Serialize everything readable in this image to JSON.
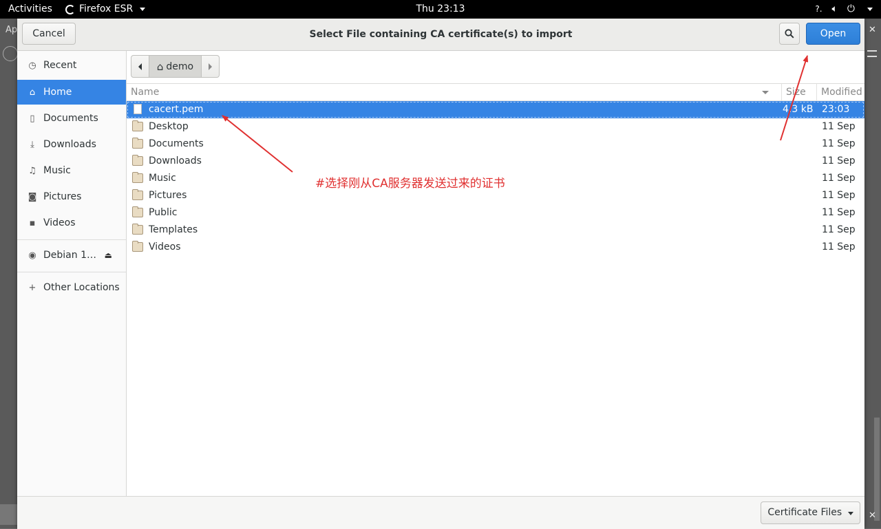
{
  "topbar": {
    "activities": "Activities",
    "app_name": "Firefox ESR",
    "clock": "Thu 23:13"
  },
  "background": {
    "left_stub": "Ap",
    "close_glyph": "✕"
  },
  "dialog": {
    "title": "Select File containing CA certificate(s) to import",
    "cancel_label": "Cancel",
    "open_label": "Open"
  },
  "sidebar": {
    "items": [
      {
        "label": "Recent",
        "icon": "clock-icon",
        "glyph": "◷"
      },
      {
        "label": "Home",
        "icon": "home-icon",
        "glyph": "⌂"
      },
      {
        "label": "Documents",
        "icon": "document-icon",
        "glyph": "▯"
      },
      {
        "label": "Downloads",
        "icon": "download-icon",
        "glyph": "⤓"
      },
      {
        "label": "Music",
        "icon": "music-icon",
        "glyph": "♫"
      },
      {
        "label": "Pictures",
        "icon": "camera-icon",
        "glyph": "◙"
      },
      {
        "label": "Videos",
        "icon": "video-icon",
        "glyph": "▪"
      }
    ],
    "device": {
      "label": "Debian 1…",
      "icon": "disc-icon",
      "glyph": "◉"
    },
    "other": {
      "label": "Other Locations",
      "icon": "plus-icon",
      "glyph": "+"
    }
  },
  "pathbar": {
    "current": "demo"
  },
  "filelist": {
    "columns": {
      "name": "Name",
      "size": "Size",
      "modified": "Modified"
    },
    "rows": [
      {
        "name": "cacert.pem",
        "size": "4.3 kB",
        "modified": "23:03",
        "type": "file",
        "selected": true
      },
      {
        "name": "Desktop",
        "size": "",
        "modified": "11 Sep",
        "type": "folder"
      },
      {
        "name": "Documents",
        "size": "",
        "modified": "11 Sep",
        "type": "folder"
      },
      {
        "name": "Downloads",
        "size": "",
        "modified": "11 Sep",
        "type": "folder"
      },
      {
        "name": "Music",
        "size": "",
        "modified": "11 Sep",
        "type": "folder"
      },
      {
        "name": "Pictures",
        "size": "",
        "modified": "11 Sep",
        "type": "folder"
      },
      {
        "name": "Public",
        "size": "",
        "modified": "11 Sep",
        "type": "folder"
      },
      {
        "name": "Templates",
        "size": "",
        "modified": "11 Sep",
        "type": "folder"
      },
      {
        "name": "Videos",
        "size": "",
        "modified": "11 Sep",
        "type": "folder"
      }
    ]
  },
  "footer": {
    "filter_label": "Certificate Files"
  },
  "annotation": {
    "text": "#选择刚从CA服务器发送过来的证书",
    "color": "#e03030"
  },
  "colors": {
    "accent": "#3584e4",
    "topbar": "#000000"
  }
}
